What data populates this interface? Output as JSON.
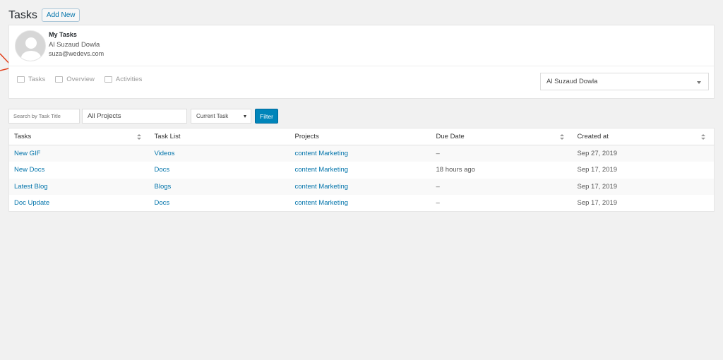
{
  "header": {
    "title": "Tasks",
    "add_new_label": "Add New"
  },
  "profile": {
    "section_label": "My Tasks",
    "name": "Al Suzaud Dowla",
    "email": "suza@wedevs.com",
    "tabs": [
      {
        "label": "Tasks",
        "icon": "tasks-icon"
      },
      {
        "label": "Overview",
        "icon": "overview-icon"
      },
      {
        "label": "Activities",
        "icon": "activities-icon"
      }
    ],
    "user_select": "Al Suzaud Dowla"
  },
  "filters": {
    "search_placeholder": "Search by Task Title",
    "projects_value": "All Projects",
    "task_filter": "Current Task",
    "filter_label": "Filter"
  },
  "table": {
    "columns": [
      "Tasks",
      "Task List",
      "Projects",
      "Due Date",
      "Created at"
    ],
    "rows": [
      {
        "task": "New GIF",
        "list": "Videos",
        "project": "content Marketing",
        "due": "–",
        "created": "Sep 27, 2019"
      },
      {
        "task": "New Docs",
        "list": "Docs",
        "project": "content Marketing",
        "due": "18 hours ago",
        "created": "Sep 17, 2019"
      },
      {
        "task": "Latest Blog",
        "list": "Blogs",
        "project": "content Marketing",
        "due": "–",
        "created": "Sep 17, 2019"
      },
      {
        "task": "Doc Update",
        "list": "Docs",
        "project": "content Marketing",
        "due": "–",
        "created": "Sep 17, 2019"
      }
    ]
  },
  "colors": {
    "accent": "#0073aa",
    "button_primary": "#0085ba",
    "annotation": "#e2401c"
  }
}
